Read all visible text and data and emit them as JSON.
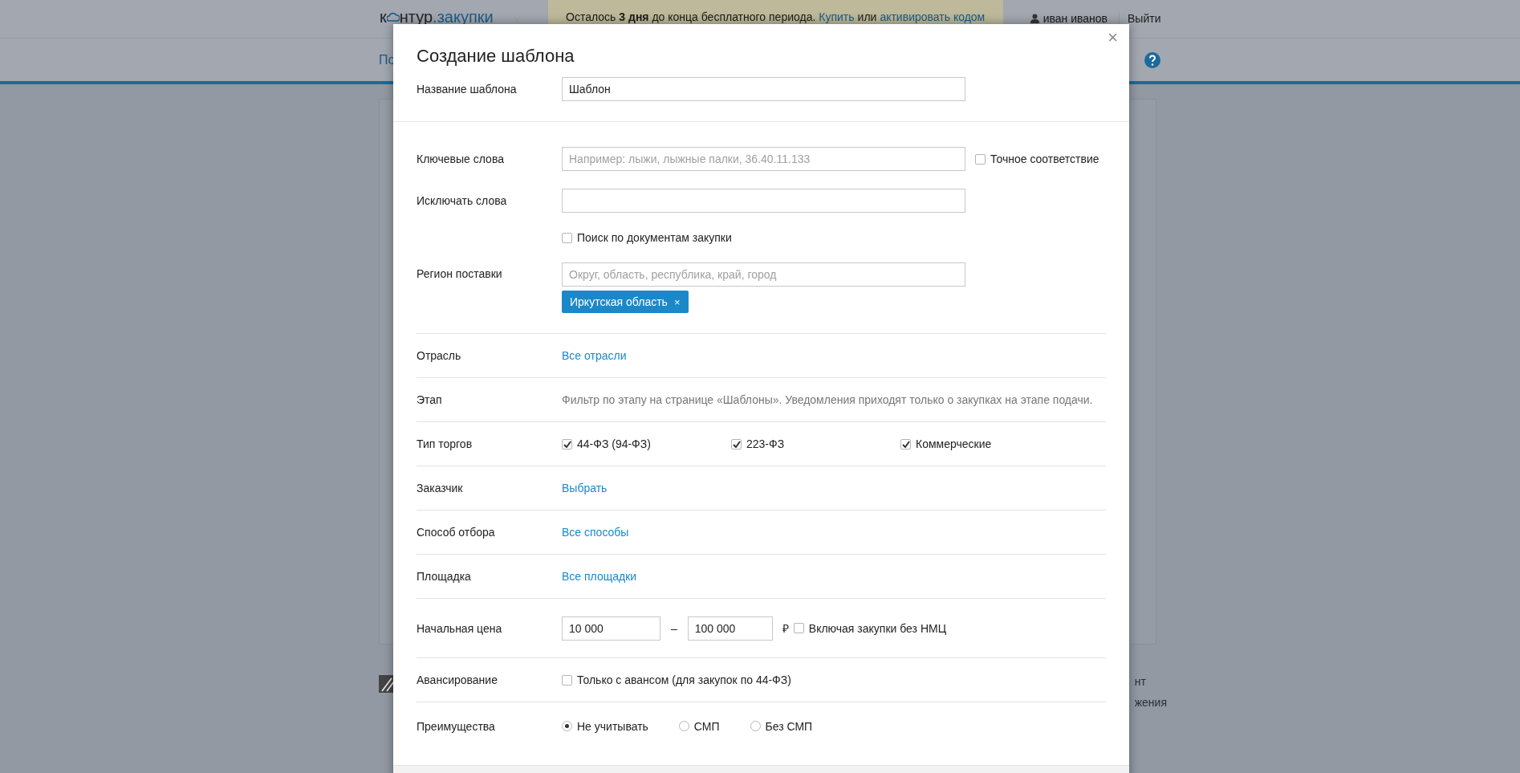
{
  "header": {
    "logo_left": "к",
    "logo_mid": "нтур",
    "logo_right": ".закупки",
    "trial_banner": "Осталось **3 дня** до конца бесплатного периода.",
    "buy_link": "Купить",
    "or": "или",
    "activate_link": "активировать кодом",
    "user": "иван иванов",
    "logout": "Выйти"
  },
  "nav": {
    "link": "По"
  },
  "footer": {
    "texts": [
      "нт",
      "жения"
    ]
  },
  "modal": {
    "title": "Создание шаблона",
    "close": "×",
    "name_row": {
      "label": "Название шаблона",
      "value": "Шаблон"
    },
    "keywords": {
      "label": "Ключевые слова",
      "placeholder": "Например: лыжи, лыжные палки, 36.40.11.133",
      "exact": {
        "label": "Точное соответствие",
        "checked": false
      }
    },
    "exclude": {
      "label": "Исключать слова"
    },
    "doc_search": {
      "label": "Поиск по документам закупки",
      "checked": false
    },
    "region": {
      "label": "Регион поставки",
      "placeholder": "Округ, область, республика, край, город",
      "tags": [
        "Иркутская область"
      ],
      "tag_remove": "×"
    },
    "rows": [
      {
        "kind": "link",
        "label": "Отрасль",
        "link": "Все отрасли"
      },
      {
        "kind": "note",
        "label": "Этап",
        "text": "Фильтр по этапу на странице «Шаблоны». Уведомления приходят только о закупках на этапе подачи."
      },
      {
        "kind": "checks",
        "label": "Тип торгов",
        "options": [
          {
            "label": "44-ФЗ (94-ФЗ)",
            "checked": true
          },
          {
            "label": "223-ФЗ",
            "checked": true
          },
          {
            "label": "Коммерческие",
            "checked": true
          }
        ]
      },
      {
        "kind": "link",
        "label": "Заказчик",
        "link": "Выбрать"
      },
      {
        "kind": "link",
        "label": "Способ отбора",
        "link": "Все способы"
      },
      {
        "kind": "link",
        "label": "Площадка",
        "link": "Все площадки"
      },
      {
        "kind": "price",
        "label": "Начальная цена",
        "from": "10 000",
        "dash": "–",
        "to": "100 000",
        "currency": "₽",
        "option": {
          "label": "Включая закупки без НМЦ",
          "checked": false
        }
      },
      {
        "kind": "check",
        "label": "Авансирование",
        "option": {
          "label": "Только с авансом (для закупок по 44-ФЗ)",
          "checked": false
        }
      },
      {
        "kind": "radios",
        "label": "Преимущества",
        "options": [
          {
            "label": "Не учитывать",
            "selected": true
          },
          {
            "label": "СМП",
            "selected": false
          },
          {
            "label": "Без СМП",
            "selected": false
          }
        ]
      }
    ]
  }
}
